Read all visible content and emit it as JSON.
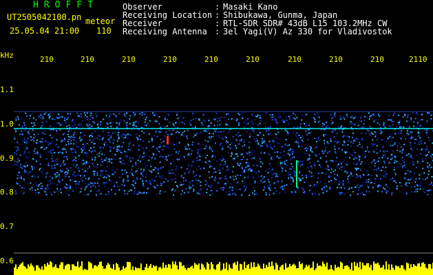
{
  "header": {
    "title": "HROFFT",
    "filename": "UT2505042100.pn",
    "meteor_label": "meteor",
    "datetime": "25.05.04 21:00",
    "count": "110"
  },
  "info": [
    {
      "key": "Observer",
      "sep": ":",
      "value": "Masaki Kano"
    },
    {
      "key": "Receiving Location",
      "sep": ":",
      "value": "Shibukawa, Gunma, Japan"
    },
    {
      "key": "Receiver",
      "sep": ":",
      "value": "RTL-SDR SDR# 43dB L15 103.2MHz CW"
    },
    {
      "key": "Receiving Antenna",
      "sep": ":",
      "value": "3el Yagi(V) Az 330 for Vladivostok"
    }
  ],
  "axis": {
    "y_unit": "kHz",
    "y_ticks": [
      "1.1",
      "1.0",
      "0.9",
      "0.8",
      "0.7",
      "0.6"
    ],
    "x_ticks": [
      "210",
      "210",
      "210",
      "210",
      "210",
      "210",
      "210",
      "210",
      "210",
      "2110"
    ]
  },
  "colors": {
    "title": "#00ff00",
    "info": "#ffffff",
    "axis_labels": "#ffff00",
    "background": "#000000",
    "trace": "#00ffff",
    "spectrum_low": "#000060",
    "spectrum_high": "#ff0000",
    "power_bar": "#ffff00"
  }
}
